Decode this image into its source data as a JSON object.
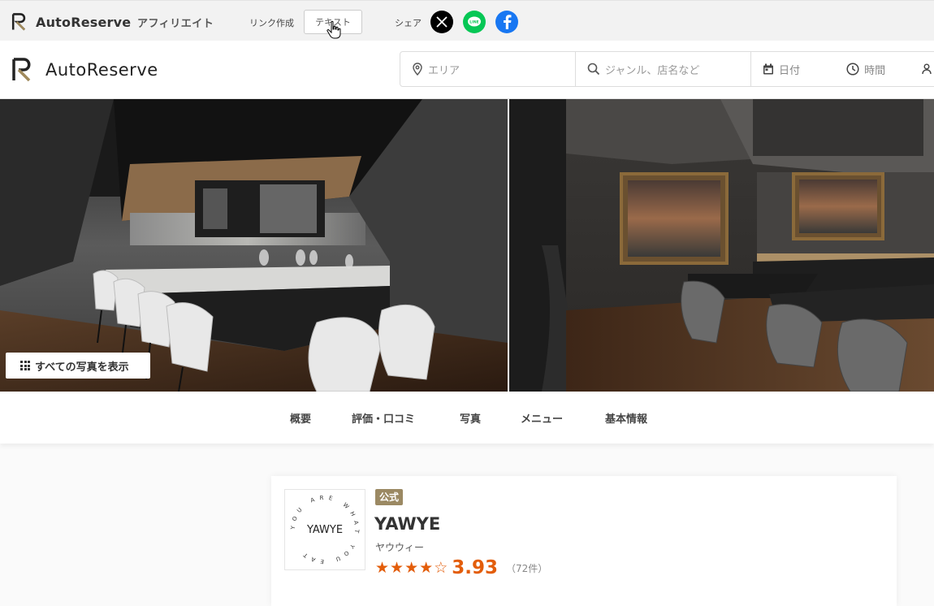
{
  "affiliate_bar": {
    "brand": "AutoReserve",
    "affiliate_label": "アフィリエイト",
    "link_label": "リンク作成",
    "text_button": "テキスト",
    "share_label": "シェア",
    "social": [
      {
        "name": "x",
        "glyph": "𝕏",
        "color": "#000000"
      },
      {
        "name": "line",
        "glyph": "LINE",
        "color": "#06c755"
      },
      {
        "name": "facebook",
        "glyph": "f",
        "color": "#1877f2"
      }
    ]
  },
  "header": {
    "brand": "AutoReserve",
    "search": {
      "area_placeholder": "エリア",
      "genre_placeholder": "ジャンル、店名など",
      "date_label": "日付",
      "time_label": "時間"
    }
  },
  "gallery": {
    "show_all_label": "すべての写真を表示"
  },
  "tabs": [
    "概要",
    "評価・口コミ",
    "写真",
    "メニュー",
    "基本情報"
  ],
  "restaurant": {
    "official_badge": "公式",
    "logo_text": "YAWYE",
    "logo_ring_text": "YOU ARE WHAT YOU EAT",
    "name": "YAWYE",
    "kana": "ヤウウィー",
    "rating": 3.93,
    "rating_text": "3.93",
    "stars_filled": 4,
    "stars_total": 5,
    "review_count": "（72件）"
  },
  "colors": {
    "accent": "#e35d0a",
    "badge": "#9b8963",
    "logo_gold": "#a08a5c"
  }
}
